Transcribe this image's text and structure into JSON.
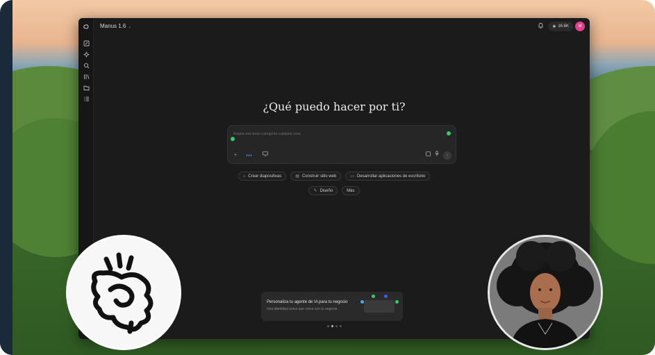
{
  "app": {
    "model_name": "Manus 1.6",
    "credits": "16.6K",
    "avatar_initial": "M"
  },
  "sidebar": {
    "items": [
      {
        "icon": "logo-icon"
      },
      {
        "icon": "new-task-icon"
      },
      {
        "icon": "agents-icon"
      },
      {
        "icon": "search-icon"
      },
      {
        "icon": "library-icon"
      },
      {
        "icon": "folder-icon"
      },
      {
        "icon": "tasks-icon"
      }
    ]
  },
  "main": {
    "headline": "¿Qué puedo hacer por ti?",
    "composer": {
      "placeholder": "Asigna una tarea o pregunta cualquier cosa"
    },
    "chips_row1": [
      {
        "label": "Crear diapositivas",
        "icon": "slides-icon"
      },
      {
        "label": "Construir sitio web",
        "icon": "website-icon"
      },
      {
        "label": "Desarrollar aplicaciones de escritorio",
        "icon": "desktop-icon"
      }
    ],
    "chips_row2": [
      {
        "label": "Diseño",
        "icon": "design-icon"
      },
      {
        "label": "Más",
        "icon": ""
      }
    ],
    "promo": {
      "title": "Personaliza tu agente de IA para tu negocio",
      "subtitle": "Una identidad única que crece con tu negocio."
    }
  },
  "colors": {
    "accent_green": "#2fcf6a",
    "avatar_pink": "#e0408c",
    "window_bg": "#1b1b1b"
  }
}
